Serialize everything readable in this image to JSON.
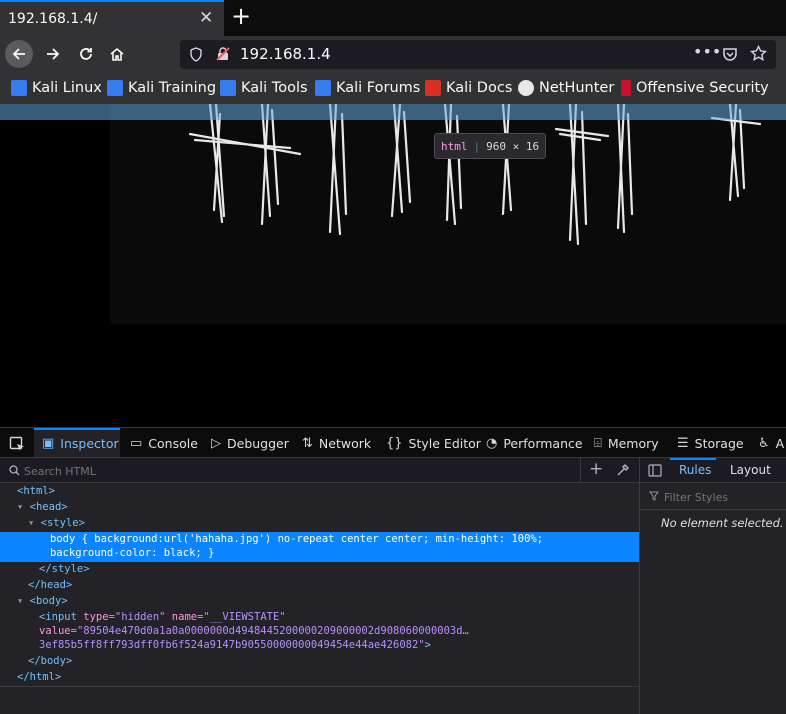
{
  "tab": {
    "title": "192.168.1.4/"
  },
  "urlbar": {
    "url": "192.168.1.4"
  },
  "bookmarks": [
    {
      "label": "Kali Linux",
      "icon": "kali-icon"
    },
    {
      "label": "Kali Training",
      "icon": "kali-icon"
    },
    {
      "label": "Kali Tools",
      "icon": "kali-icon"
    },
    {
      "label": "Kali Forums",
      "icon": "kali-icon"
    },
    {
      "label": "Kali Docs",
      "icon": "kali-docs-icon"
    },
    {
      "label": "NetHunter",
      "icon": "nethunter-icon"
    },
    {
      "label": "Offensive Security",
      "icon": "offsec-icon"
    }
  ],
  "tooltip": {
    "tag": "html",
    "size": "960 × 16"
  },
  "devtools": {
    "tabs": [
      "Inspector",
      "Console",
      "Debugger",
      "Network",
      "Style Editor",
      "Performance",
      "Memory",
      "Storage",
      "A"
    ],
    "search_placeholder": "Search HTML",
    "sidebar": {
      "tabs": [
        "Rules",
        "Layout"
      ],
      "filter_placeholder": "Filter Styles",
      "empty": "No element selected."
    },
    "markup": {
      "html_open": "<html>",
      "head_open": "<head>",
      "style_open": "<style>",
      "style_line1": "body { background:url('hahaha.jpg') no-repeat center center; min-height: 100%;",
      "style_line2": "background-color: black; }",
      "style_close": "</style>",
      "head_close": "</head>",
      "body_open": "<body>",
      "input_tag": "input",
      "input_attr_type": "type",
      "input_type_val": "\"hidden\"",
      "input_attr_name": "name",
      "input_name_val": "\"__VIEWSTATE\"",
      "input_attr_value": "value",
      "input_value_line1": "\"89504e470d0a1a0a0000000d4948445200000209000002d908060000003d…",
      "input_value_line2": "3ef85b5ff8ff793dff0fb6f524a9147b90550000000049454e44ae426082\"",
      "body_close": "</body>",
      "html_close": "</html>"
    }
  }
}
